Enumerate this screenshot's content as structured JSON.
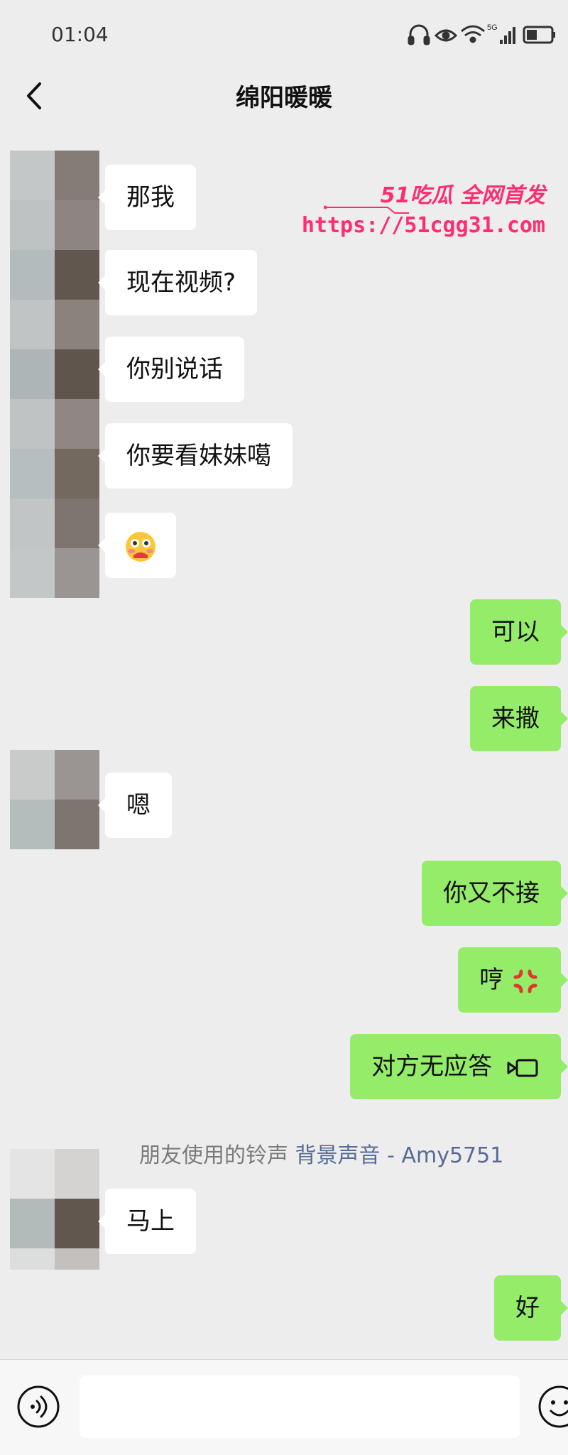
{
  "status_bar": {
    "time": "01:04",
    "network": "5G"
  },
  "header": {
    "title": "绵阳暖暖"
  },
  "watermark": {
    "title": "51吃瓜 全网首发",
    "url": "https://51cgg31.com"
  },
  "messages": [
    {
      "side": "in",
      "text": "那我"
    },
    {
      "side": "in",
      "text": "现在视频?"
    },
    {
      "side": "in",
      "text": "你别说话"
    },
    {
      "side": "in",
      "text": "你要看妹妹噶"
    },
    {
      "side": "in",
      "emoji": "flushed-face-emoji"
    },
    {
      "side": "out",
      "text": "可以"
    },
    {
      "side": "out",
      "text": "来撒"
    },
    {
      "side": "in",
      "text": "嗯"
    },
    {
      "side": "out",
      "text": "你又不接"
    },
    {
      "side": "out",
      "text": "哼",
      "emoji": "anger-symbol-emoji"
    },
    {
      "side": "out",
      "text": "对方无应答",
      "icon": "video-call-icon"
    },
    {
      "side": "in",
      "text": "马上"
    },
    {
      "side": "out",
      "text": "好"
    }
  ],
  "ringtone": {
    "prefix": "朋友使用的铃声",
    "link": "背景声音 - Amy5751"
  },
  "input_bar": {
    "voice_icon": "voice-icon",
    "emoji_icon": "emoji-icon"
  },
  "colors": {
    "background": "#ededed",
    "outgoing_bubble": "#95ec69",
    "incoming_bubble": "#ffffff",
    "watermark": "#ff2d6f",
    "link": "#576b95"
  }
}
